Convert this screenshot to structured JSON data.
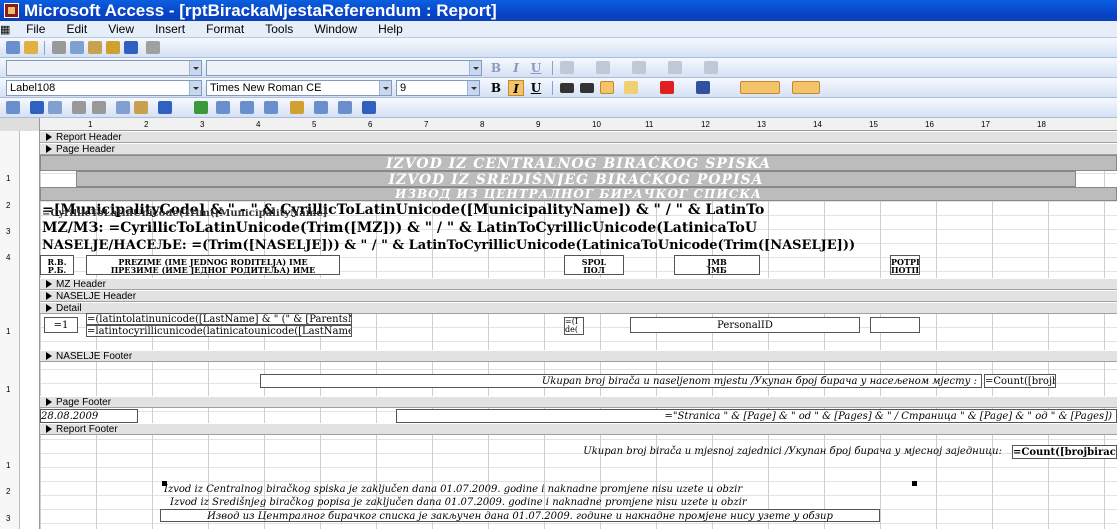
{
  "window": {
    "title": "Microsoft Access - [rptBirackaMjestaReferendum : Report]"
  },
  "menu": [
    "File",
    "Edit",
    "View",
    "Insert",
    "Format",
    "Tools",
    "Window",
    "Help"
  ],
  "formatting": {
    "control": "Label108",
    "font": "Times New Roman CE",
    "size": "9"
  },
  "ruler": [
    "1",
    "2",
    "3",
    "4",
    "5",
    "6",
    "7",
    "8",
    "9",
    "10",
    "11",
    "12",
    "13",
    "14",
    "15",
    "16",
    "17",
    "18"
  ],
  "vruler": [
    "1",
    "2",
    "3",
    "4",
    "1",
    "1",
    "1",
    "2",
    "3"
  ],
  "sections": {
    "report_header": "Report Header",
    "page_header": "Page Header",
    "mz_header": "MZ Header",
    "naselje_header": "NASELJE Header",
    "detail": "Detail",
    "naselje_footer": "NASELJE Footer",
    "page_footer": "Page Footer",
    "report_footer": "Report Footer"
  },
  "page_header": {
    "title1": "IZVOD IZ CENTRALNOG BIRAČKOG SPISKA",
    "title2": "IZVOD IZ SREDIŠNJEG  BIRAČKOG POPISA",
    "title3": "ИЗВОД ИЗ ЦЕНТРАЛНОГ БИРАЧКОГ СПИСКА",
    "expr_municipality": "=[MunicipalityCode] & \" - \" & CyrillicToLatinUnicode([MunicipalityName]) & \" / \" & LatinTo",
    "expr_municipality_under": "=CyrillicToLatinUnicode(Trim([MunicipalityName]",
    "expr_mz": "MZ/МЗ: =CyrillicToLatinUnicode(Trim([MZ])) & \" / \" & LatinToCyrillicUnicode(LatinicaToU",
    "expr_naselje": "NASELJE/НАСЕЉЕ: =(Trim([NASELJE])) & \" / \" & LatinToCyrillicUnicode(LatinicaToUnicode(Trim([NASELJE]))",
    "col_rb1": "R.B.",
    "col_rb2": "Р.Б.",
    "col_name1": "PREZIME (IME JEDNOG RODITELJA) IME",
    "col_name2": "ПРЕЗИМЕ (ИМЕ ЈЕДНОГ РОДИТЕЉА) ИМЕ",
    "col_spol1": "SPOL",
    "col_spol2": "ПОЛ",
    "col_jmb1": "JMB",
    "col_jmb2": "ЈМБ",
    "col_potpis1": "POTPIS",
    "col_potpis2": "ПОТПИС"
  },
  "detail": {
    "rb": "=1",
    "name_latin": "=(latintolatinunicode([LastName] & \" (\" & [ParentsNam",
    "name_cyr": "=latintocyrillicunicode(latinicatounicode([LastName] &",
    "sex_a": "=(I",
    "sex_b": "de(",
    "personal_id": "PersonalID"
  },
  "naselje_footer": {
    "text": "Ukupan broj birača u naseljenom mjestu /Укупан број бирача у насељеном мјесту :",
    "count": "=Count([brojbiracackispisk"
  },
  "page_footer": {
    "date": "28.08.2009",
    "expr": "=\"Stranica \" & [Page] & \" od \" & [Pages] & \" / Страница \" & [Page] & \" од \" & [Pages])"
  },
  "report_footer": {
    "text": "Ukupan broj birača u mjesnoj zajednici /Укупан број бирача у мјесној заједници:",
    "count": "=Count([brojbiracackispisk",
    "line1": "Izvod iz Centralnog biračkog spiska je zaključen dana 01.07.2009. godine i naknadne promjene nisu uzete u obzir",
    "line2": "Izvod iz Središnjeg biračkog popisa je zaključen dana 01.07.2009. godine i naknadne promjene nisu uzete u obzir",
    "line3": "Извод из Централног бирачког списка је закључен дана 01.07.2009. године и накнадне промјене нису узете у обзир"
  },
  "colors": {
    "titlebar": "#0845c8",
    "band": "#e2e2e2",
    "title_fill": "#bcbcbc"
  }
}
